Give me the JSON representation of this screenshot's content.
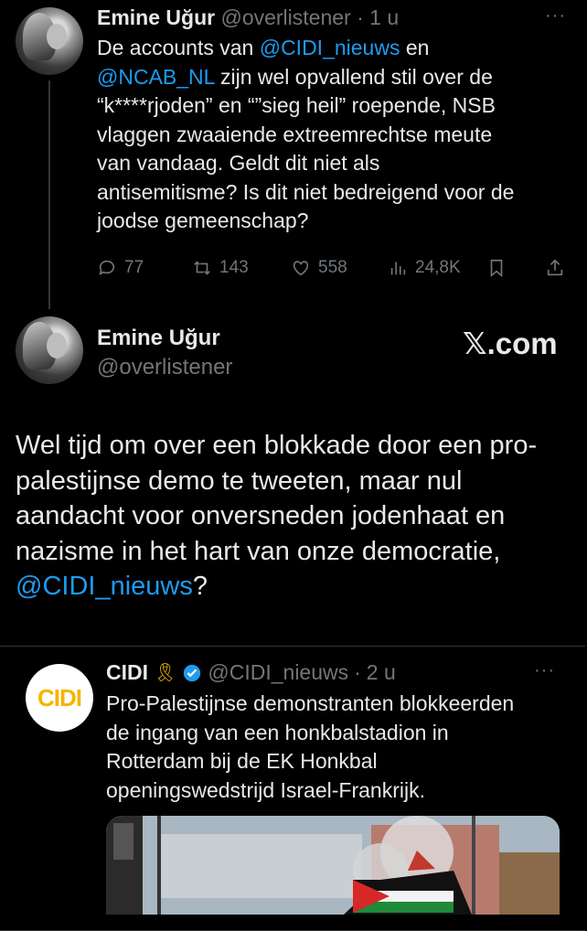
{
  "tweet1": {
    "name": "Emine Uğur",
    "handle": "@overlistener",
    "sep": "·",
    "time": "1 u",
    "more": "···",
    "text_parts": {
      "t1": "De accounts van ",
      "m1": "@CIDI_nieuws",
      "t2": " en",
      "m2": "@NCAB_NL",
      "t3": " zijn wel opvallend stil over de",
      "l3": "“k****rjoden” en “”sieg heil” roepende, NSB",
      "l4": "vlaggen zwaaiende extreemrechtse meute",
      "l5": "van vandaag. Geldt dit niet als",
      "l6": "antisemitisme? Is dit niet bedreigend voor de",
      "l7": "joodse gemeenschap?"
    },
    "actions": {
      "replies": "77",
      "retweets": "143",
      "likes": "558",
      "views": "24,8K"
    }
  },
  "tweet2": {
    "name": "Emine Uğur",
    "handle": "@overlistener",
    "brand": "𝕏.com",
    "lines": {
      "l1": "Wel tijd om over een blokkade door een pro-",
      "l2": "palestijnse demo te tweeten, maar nul",
      "l3": "aandacht voor onversneden jodenhaat en",
      "l4": "nazisme in het hart van onze democratie,",
      "mention": "@CIDI_nieuws",
      "end": "?"
    }
  },
  "quote": {
    "logo": "CIDI",
    "name": "CIDI",
    "ribbon": "🎗",
    "handle": "@CIDI_nieuws",
    "sep": "·",
    "time": "2 u",
    "more": "···",
    "lines": {
      "l1": "Pro-Palestijnse demonstranten blokkeerden",
      "l2": "de ingang van een honkbalstadion in",
      "l3": "Rotterdam bij de EK Honkbal",
      "l4": "openingswedstrijd Israel-Frankrijk."
    }
  },
  "colors": {
    "accent": "#1d9bf0",
    "muted": "#71767b",
    "text": "#e7e9ea",
    "background": "#000000",
    "cidi_yellow": "#f4b400"
  }
}
